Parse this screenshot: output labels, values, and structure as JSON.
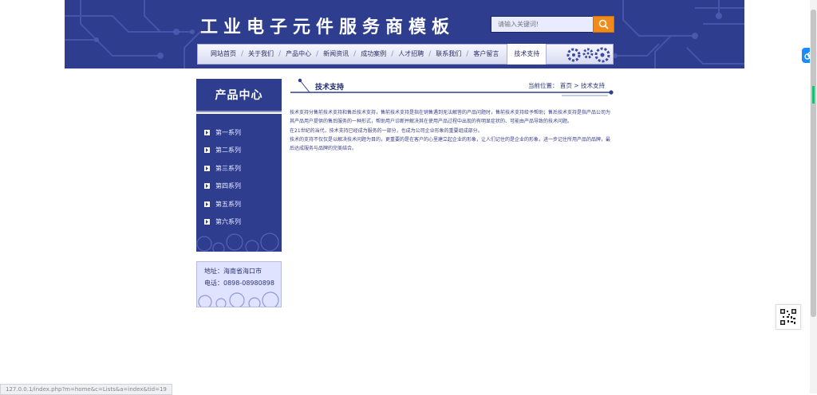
{
  "header": {
    "site_title": "工业电子元件服务商模板",
    "search": {
      "placeholder": "请输入关键词!"
    },
    "nav": [
      {
        "label": "网站首页"
      },
      {
        "label": "关于我们"
      },
      {
        "label": "产品中心"
      },
      {
        "label": "新闻资讯"
      },
      {
        "label": "成功案例"
      },
      {
        "label": "人才招聘"
      },
      {
        "label": "联系我们"
      },
      {
        "label": "客户留言"
      }
    ],
    "nav_active": "技术支持"
  },
  "sidebar": {
    "title": "产品中心",
    "items": [
      {
        "label": "第一系列"
      },
      {
        "label": "第二系列"
      },
      {
        "label": "第三系列"
      },
      {
        "label": "第四系列"
      },
      {
        "label": "第五系列"
      },
      {
        "label": "第六系列"
      }
    ],
    "contact": {
      "address": "地址：海南省海口市",
      "phone": "电话：0898-08980898"
    }
  },
  "main": {
    "title": "技术支持",
    "breadcrumb": {
      "prefix": "当前位置：",
      "home": "首页",
      "sep": ">",
      "current": "技术支持"
    },
    "paragraphs": [
      "技术支持分售前技术支持和售后技术支持，售前技术支持是指在销售遇到无法解答的产品问题时，售前技术支持给予帮助；售后技术支持是指产品公司为其产品用户提供的售后服务的一种形式，帮助用户诊断并解决其在使用产品过程中出现的有明显症状的、可能由产品导致的技术问题。",
      "在21世纪的当代，技术支持已经成为服务的一部分，也成为公司企业形象的重要组成部分。",
      "技术的支持不仅仅是以解决技术问题为目的，更重要的是在客户的心里建立起企业的形象，让人们记住的是企业的形象，进一步记住所用产品的品牌，最后达成服务与品牌的完美结合。"
    ]
  },
  "status_bar": {
    "url": "127.0.0.1/index.php?m=home&c=Lists&a=index&tid=19"
  },
  "colors": {
    "primary": "#2e3d8e",
    "accent": "#f08b1b",
    "side_bg": "#2e3d8e",
    "contact_bg": "#dfe3ff"
  },
  "icons": [
    "search-icon",
    "gear-icon",
    "arrow-right-icon",
    "cloud-icon",
    "qr-code-icon"
  ]
}
